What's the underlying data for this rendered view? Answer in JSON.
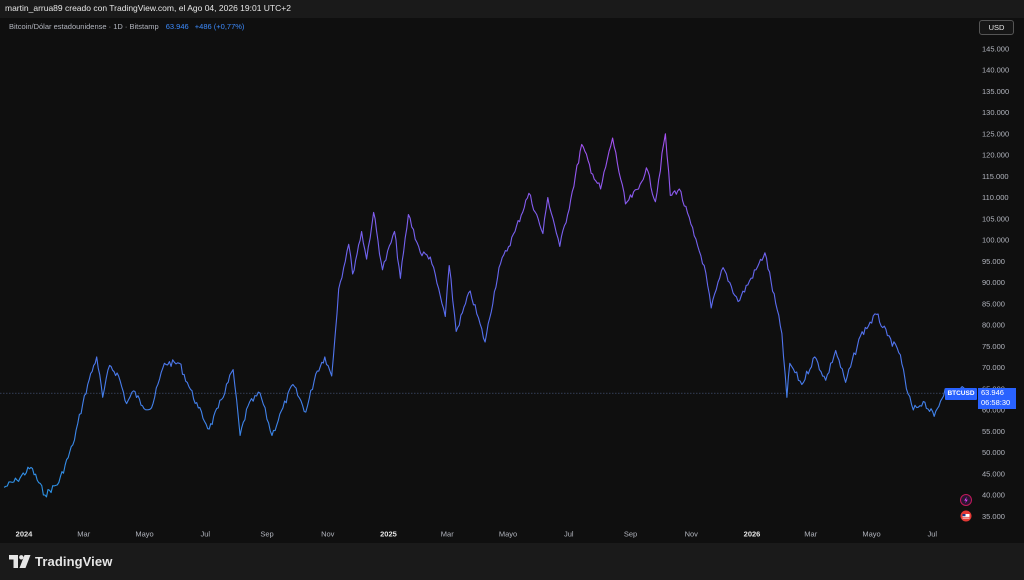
{
  "header": {
    "title": "martin_arrua89 creado con TradingView.com, el Ago 04, 2026 19:01 UTC+2"
  },
  "legend": {
    "symbol_text": "Bitcoin/Dólar estadounidense · 1D · Bitstamp",
    "price": "63.946",
    "change": "+486 (+0,77%)"
  },
  "currency_button": "USD",
  "price_tag": {
    "symbol": "BTCUSD",
    "price": "63.946",
    "countdown": "06:58:30"
  },
  "footer": {
    "brand": "TradingView"
  },
  "colors": {
    "background": "#0f0f0f",
    "line_start": "#2f86e0",
    "line_peak": "#9d4eed",
    "price_label": "#2962ff",
    "axis_text": "#b2b5be"
  },
  "icons": [
    "tradingview-logo-icon",
    "lightning-icon",
    "flag-icon"
  ],
  "chart_data": {
    "type": "line",
    "title": "Bitcoin/Dólar estadounidense · 1D · Bitstamp",
    "xlabel": "",
    "ylabel": "",
    "grid": false,
    "ylim": [
      33000,
      148000
    ],
    "y_ticks": [
      35000,
      40000,
      45000,
      50000,
      55000,
      60000,
      65000,
      70000,
      75000,
      80000,
      85000,
      90000,
      95000,
      100000,
      105000,
      110000,
      115000,
      120000,
      125000,
      130000,
      135000,
      140000,
      145000
    ],
    "y_tick_labels": [
      "35.000",
      "40.000",
      "45.000",
      "50.000",
      "55.000",
      "60.000",
      "65.000",
      "70.000",
      "75.000",
      "80.000",
      "85.000",
      "90.000",
      "95.000",
      "100.000",
      "105.000",
      "110.000",
      "115.000",
      "120.000",
      "125.000",
      "130.000",
      "135.000",
      "140.000",
      "145.000"
    ],
    "x_ticks": [
      {
        "label": "2024",
        "date": "2024-01-01",
        "bold": true
      },
      {
        "label": "Mar",
        "date": "2024-03-01"
      },
      {
        "label": "Mayo",
        "date": "2024-05-01"
      },
      {
        "label": "Jul",
        "date": "2024-07-01"
      },
      {
        "label": "Sep",
        "date": "2024-09-01"
      },
      {
        "label": "Nov",
        "date": "2024-11-01"
      },
      {
        "label": "2025",
        "date": "2025-01-01",
        "bold": true
      },
      {
        "label": "Mar",
        "date": "2025-03-01"
      },
      {
        "label": "Mayo",
        "date": "2025-05-01"
      },
      {
        "label": "Jul",
        "date": "2025-07-01"
      },
      {
        "label": "Sep",
        "date": "2025-09-01"
      },
      {
        "label": "Nov",
        "date": "2025-11-01"
      },
      {
        "label": "2026",
        "date": "2026-01-01",
        "bold": true
      },
      {
        "label": "Mar",
        "date": "2026-03-01"
      },
      {
        "label": "Mayo",
        "date": "2026-05-01"
      },
      {
        "label": "Jul",
        "date": "2026-07-01"
      }
    ],
    "x_range": [
      "2023-12-13",
      "2026-09-08"
    ],
    "last_price": 63946,
    "series": [
      {
        "values": [
          [
            "2023-12-12",
            41800
          ],
          [
            "2023-12-25",
            43500
          ],
          [
            "2024-01-08",
            46500
          ],
          [
            "2024-01-22",
            40000
          ],
          [
            "2024-02-05",
            43000
          ],
          [
            "2024-02-19",
            51800
          ],
          [
            "2024-02-29",
            61500
          ],
          [
            "2024-03-05",
            66000
          ],
          [
            "2024-03-14",
            72500
          ],
          [
            "2024-03-20",
            63000
          ],
          [
            "2024-03-27",
            70500
          ],
          [
            "2024-04-05",
            68000
          ],
          [
            "2024-04-13",
            61500
          ],
          [
            "2024-04-20",
            64500
          ],
          [
            "2024-04-29",
            61000
          ],
          [
            "2024-05-08",
            60500
          ],
          [
            "2024-05-21",
            71000
          ],
          [
            "2024-06-05",
            71000
          ],
          [
            "2024-06-13",
            66500
          ],
          [
            "2024-06-24",
            60500
          ],
          [
            "2024-07-05",
            55500
          ],
          [
            "2024-07-14",
            60500
          ],
          [
            "2024-07-29",
            69500
          ],
          [
            "2024-08-05",
            54000
          ],
          [
            "2024-08-13",
            61000
          ],
          [
            "2024-08-25",
            64000
          ],
          [
            "2024-09-06",
            54000
          ],
          [
            "2024-09-17",
            60500
          ],
          [
            "2024-09-27",
            66000
          ],
          [
            "2024-10-10",
            59500
          ],
          [
            "2024-10-20",
            68500
          ],
          [
            "2024-10-29",
            72500
          ],
          [
            "2024-11-05",
            68000
          ],
          [
            "2024-11-12",
            88500
          ],
          [
            "2024-11-22",
            99000
          ],
          [
            "2024-11-26",
            92000
          ],
          [
            "2024-12-05",
            102000
          ],
          [
            "2024-12-10",
            95500
          ],
          [
            "2024-12-17",
            106500
          ],
          [
            "2024-12-26",
            93000
          ],
          [
            "2025-01-07",
            102000
          ],
          [
            "2025-01-13",
            91000
          ],
          [
            "2025-01-21",
            106000
          ],
          [
            "2025-02-02",
            97000
          ],
          [
            "2025-02-12",
            96000
          ],
          [
            "2025-02-27",
            82000
          ],
          [
            "2025-03-03",
            94000
          ],
          [
            "2025-03-10",
            78500
          ],
          [
            "2025-03-24",
            88000
          ],
          [
            "2025-04-08",
            76000
          ],
          [
            "2025-04-22",
            93500
          ],
          [
            "2025-05-08",
            102000
          ],
          [
            "2025-05-22",
            111000
          ],
          [
            "2025-06-05",
            101500
          ],
          [
            "2025-06-10",
            110000
          ],
          [
            "2025-06-22",
            98500
          ],
          [
            "2025-07-03",
            109500
          ],
          [
            "2025-07-14",
            122500
          ],
          [
            "2025-07-25",
            115500
          ],
          [
            "2025-08-02",
            112000
          ],
          [
            "2025-08-14",
            124000
          ],
          [
            "2025-08-27",
            108500
          ],
          [
            "2025-09-09",
            112000
          ],
          [
            "2025-09-17",
            117000
          ],
          [
            "2025-09-26",
            109000
          ],
          [
            "2025-10-06",
            125000
          ],
          [
            "2025-10-11",
            110500
          ],
          [
            "2025-10-20",
            112000
          ],
          [
            "2025-11-04",
            101000
          ],
          [
            "2025-11-14",
            94000
          ],
          [
            "2025-11-21",
            84000
          ],
          [
            "2025-12-03",
            93500
          ],
          [
            "2025-12-18",
            85500
          ],
          [
            "2026-01-05",
            93000
          ],
          [
            "2026-01-14",
            97000
          ],
          [
            "2026-01-31",
            78000
          ],
          [
            "2026-02-05",
            63000
          ],
          [
            "2026-02-08",
            71000
          ],
          [
            "2026-02-20",
            66000
          ],
          [
            "2026-03-05",
            72500
          ],
          [
            "2026-03-16",
            67000
          ],
          [
            "2026-03-26",
            74000
          ],
          [
            "2026-04-05",
            66500
          ],
          [
            "2026-04-20",
            77500
          ],
          [
            "2026-05-06",
            82500
          ],
          [
            "2026-05-17",
            77500
          ],
          [
            "2026-05-30",
            73000
          ],
          [
            "2026-06-05",
            65000
          ],
          [
            "2026-06-12",
            60000
          ],
          [
            "2026-06-22",
            62000
          ],
          [
            "2026-07-03",
            58500
          ],
          [
            "2026-07-14",
            65000
          ],
          [
            "2026-07-24",
            63000
          ],
          [
            "2026-07-31",
            65500
          ],
          [
            "2026-08-04",
            63946
          ]
        ]
      }
    ]
  }
}
